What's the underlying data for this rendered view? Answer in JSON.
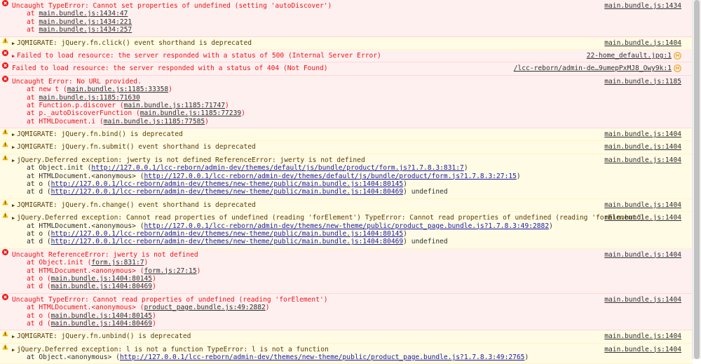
{
  "colors": {
    "error_bg": "#fff0f0",
    "error_text": "#ef1313",
    "warning_bg": "#fffbe5",
    "warning_text": "#5c3c00"
  },
  "messages": [
    {
      "level": "error",
      "text": "Uncaught TypeError: Cannot set properties of undefined (setting 'autoDiscover')",
      "source": "main.bundle.js:1434",
      "stack": [
        {
          "prefix": "at ",
          "link": "main.bundle.js:1434:47",
          "suffix": ""
        },
        {
          "prefix": "at ",
          "link": "main.bundle.js:1434:221",
          "suffix": ""
        },
        {
          "prefix": "at ",
          "link": "main.bundle.js:1434:257",
          "suffix": ""
        }
      ]
    },
    {
      "level": "warning",
      "expand": true,
      "text": "JQMIGRATE: jQuery.fn.click() event shorthand is deprecated",
      "source": "main.bundle.js:1404",
      "stack": []
    },
    {
      "level": "error",
      "expand": true,
      "text": "Failed to load resource: the server responded with a status of 500 (Internal Server Error)",
      "source": "22-home_default.jpg:1",
      "net": true,
      "stack": []
    },
    {
      "level": "error",
      "text": "Failed to load resource: the server responded with a status of 404 (Not Found)",
      "source": "/lcc-reborn/admin-de…9umepPxMJ8_Owy9k:1",
      "net": true,
      "stack": []
    },
    {
      "level": "error",
      "text": "Uncaught Error: No URL provided.",
      "source": "main.bundle.js:1185",
      "stack": [
        {
          "prefix": "at new t (",
          "link": "main.bundle.js:1185:33358",
          "suffix": ")"
        },
        {
          "prefix": "at ",
          "link": "main.bundle.js:1185:71630",
          "suffix": ""
        },
        {
          "prefix": "at Function.p.discover (",
          "link": "main.bundle.js:1185:71747",
          "suffix": ")"
        },
        {
          "prefix": "at p._autoDiscoverFunction (",
          "link": "main.bundle.js:1185:77239",
          "suffix": ")"
        },
        {
          "prefix": "at HTMLDocument.i (",
          "link": "main.bundle.js:1185:77585",
          "suffix": ")"
        }
      ]
    },
    {
      "level": "warning",
      "expand": true,
      "text": "JQMIGRATE: jQuery.fn.bind() is deprecated",
      "source": "main.bundle.js:1404",
      "stack": []
    },
    {
      "level": "warning",
      "expand": true,
      "text": "JQMIGRATE: jQuery.fn.submit() event shorthand is deprecated",
      "source": "main.bundle.js:1404",
      "stack": []
    },
    {
      "level": "warning",
      "expand": true,
      "text": "jQuery.Deferred exception: jwerty is not defined ReferenceError: jwerty is not defined",
      "source": "main.bundle.js:1404",
      "stack": [
        {
          "prefix": "at Object.init (",
          "link": "http://127.0.0.1/lcc-reborn/admin-dev/themes/default/js/bundle/product/form.js?1.7.8.3:831:7",
          "suffix": ")"
        },
        {
          "prefix": "at HTMLDocument.<anonymous> (",
          "link": "http://127.0.0.1/lcc-reborn/admin-dev/themes/default/js/bundle/product/form.js?1.7.8.3:27:15",
          "suffix": ")"
        },
        {
          "prefix": "at o (",
          "link": "http://127.0.0.1/lcc-reborn/admin-dev/themes/new-theme/public/main.bundle.js:1404:80145",
          "suffix": ")"
        },
        {
          "prefix": "at d (",
          "link": "http://127.0.0.1/lcc-reborn/admin-dev/themes/new-theme/public/main.bundle.js:1404:80469",
          "suffix": ") undefined"
        }
      ]
    },
    {
      "level": "warning",
      "expand": true,
      "text": "JQMIGRATE: jQuery.fn.change() event shorthand is deprecated",
      "source": "main.bundle.js:1404",
      "stack": []
    },
    {
      "level": "warning",
      "expand": true,
      "text": "jQuery.Deferred exception: Cannot read properties of undefined (reading 'forElement') TypeError: Cannot read properties of undefined (reading 'forElement')",
      "source": "main.bundle.js:1404",
      "stack": [
        {
          "prefix": "at HTMLDocument.<anonymous> (",
          "link": "http://127.0.0.1/lcc-reborn/admin-dev/themes/new-theme/public/product_page.bundle.js?1.7.8.3:49:2882",
          "suffix": ")"
        },
        {
          "prefix": "at o (",
          "link": "http://127.0.0.1/lcc-reborn/admin-dev/themes/new-theme/public/main.bundle.js:1404:80145",
          "suffix": ")"
        },
        {
          "prefix": "at d (",
          "link": "http://127.0.0.1/lcc-reborn/admin-dev/themes/new-theme/public/main.bundle.js:1404:80469",
          "suffix": ") undefined"
        }
      ]
    },
    {
      "level": "error",
      "text": "Uncaught ReferenceError: jwerty is not defined",
      "source": "main.bundle.js:1404",
      "stack": [
        {
          "prefix": "at Object.init (",
          "link": "form.js:831:7",
          "suffix": ")"
        },
        {
          "prefix": "at HTMLDocument.<anonymous> (",
          "link": "form.js:27:15",
          "suffix": ")"
        },
        {
          "prefix": "at o (",
          "link": "main.bundle.js:1404:80145",
          "suffix": ")"
        },
        {
          "prefix": "at d (",
          "link": "main.bundle.js:1404:80469",
          "suffix": ")"
        }
      ]
    },
    {
      "level": "error",
      "text": "Uncaught TypeError: Cannot read properties of undefined (reading 'forElement')",
      "source": "main.bundle.js:1404",
      "stack": [
        {
          "prefix": "at HTMLDocument.<anonymous> (",
          "link": "product_page.bundle.js:49:2882",
          "suffix": ")"
        },
        {
          "prefix": "at o (",
          "link": "main.bundle.js:1404:80145",
          "suffix": ")"
        },
        {
          "prefix": "at d (",
          "link": "main.bundle.js:1404:80469",
          "suffix": ")"
        }
      ]
    },
    {
      "level": "warning",
      "expand": true,
      "text": "JQMIGRATE: jQuery.fn.unbind() is deprecated",
      "source": "main.bundle.js:1404",
      "stack": []
    },
    {
      "level": "warning",
      "expand": true,
      "text": "jQuery.Deferred exception: l is not a function TypeError: l is not a function",
      "source": "main.bundle.js:1404",
      "stack": [
        {
          "prefix": "at Object.<anonymous> (",
          "link": "http://127.0.0.1/lcc-reborn/admin-dev/themes/new-theme/public/product_page.bundle.js?1.7.8.3:49:2765",
          "suffix": ")"
        }
      ]
    }
  ]
}
